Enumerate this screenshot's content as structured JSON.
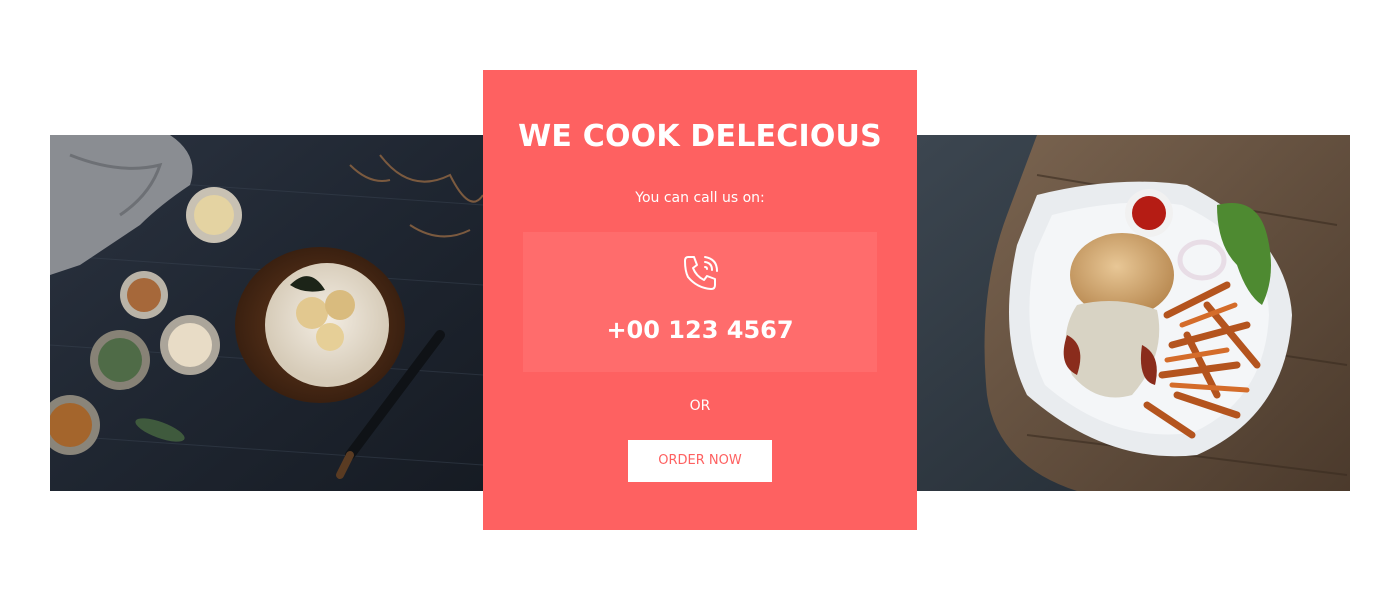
{
  "colors": {
    "accent": "#fe6161",
    "phone_box": "#ff6c6c",
    "text_on_accent": "#ffffff",
    "button_bg": "#ffffff"
  },
  "card": {
    "title": "WE COOK DELECIOUS",
    "subtitle": "You can call us on:",
    "phone_icon": "phone-call-icon",
    "phone_number": "+00 123 4567",
    "or_label": "OR",
    "order_button_label": "ORDER NOW"
  },
  "photos": {
    "left": "dessert-cake-photo",
    "right": "burger-fries-photo"
  }
}
